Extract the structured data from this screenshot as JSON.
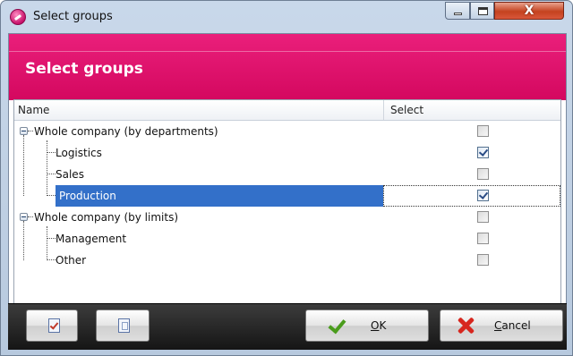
{
  "window": {
    "title": "Select groups",
    "controls": {
      "close": "X"
    }
  },
  "banner": {
    "title": "Select groups",
    "color": "#e0106c"
  },
  "grid": {
    "columns": {
      "name": "Name",
      "select": "Select"
    },
    "rows": [
      {
        "label": "Whole company (by departments)",
        "level": 0,
        "expandable": true,
        "checked": false,
        "selected": false
      },
      {
        "label": "Logistics",
        "level": 1,
        "expandable": false,
        "checked": true,
        "selected": false
      },
      {
        "label": "Sales",
        "level": 1,
        "expandable": false,
        "checked": false,
        "selected": false
      },
      {
        "label": "Production",
        "level": 1,
        "expandable": false,
        "checked": true,
        "selected": true
      },
      {
        "label": "Whole company (by limits)",
        "level": 0,
        "expandable": true,
        "checked": false,
        "selected": false
      },
      {
        "label": "Management",
        "level": 1,
        "expandable": false,
        "checked": false,
        "selected": false
      },
      {
        "label": "Other",
        "level": 1,
        "expandable": false,
        "checked": false,
        "selected": false
      }
    ]
  },
  "toolbar": {
    "check_all_icon": "check-all-icon",
    "uncheck_all_icon": "uncheck-all-icon",
    "ok": {
      "accel": "O",
      "rest": "K"
    },
    "cancel": {
      "accel": "C",
      "rest": "ancel"
    }
  }
}
